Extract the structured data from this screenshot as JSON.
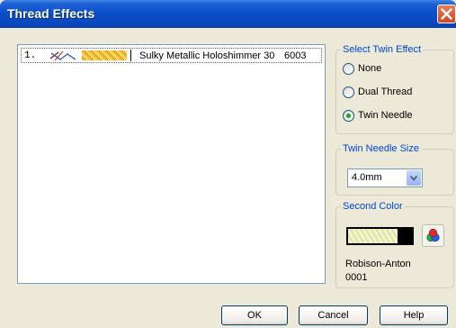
{
  "window": {
    "title": "Thread Effects"
  },
  "thread_list": [
    {
      "index": "1.",
      "name": "Sulky Metallic Holoshimmer 30",
      "code": "6003"
    }
  ],
  "twin_effect": {
    "label": "Select Twin Effect",
    "options": [
      {
        "label": "None",
        "selected": false
      },
      {
        "label": "Dual Thread",
        "selected": false
      },
      {
        "label": "Twin Needle",
        "selected": true
      }
    ]
  },
  "needle_size": {
    "label": "Twin Needle Size",
    "value": "4.0mm"
  },
  "second_color": {
    "label": "Second Color",
    "brand": "Robison-Anton",
    "code": "0001"
  },
  "buttons": {
    "ok": "OK",
    "cancel": "Cancel",
    "help": "Help"
  },
  "colors": {
    "title_bar": "#0a4ec7",
    "legend_text": "#0046d5",
    "dialog_bg": "#ece9d8",
    "radio_dot": "#21a121"
  }
}
